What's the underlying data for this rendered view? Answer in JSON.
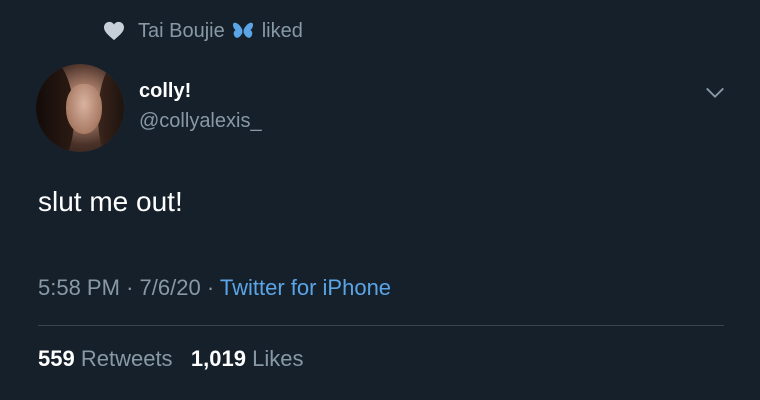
{
  "liked_by": {
    "name": "Tai Boujie",
    "action": "liked",
    "heart_icon": "heart-icon",
    "badge_icon": "butterfly-icon"
  },
  "author": {
    "display_name": "colly!",
    "handle": "@collyalexis_"
  },
  "tweet": {
    "text": "slut me out!",
    "time": "5:58 PM",
    "separator": "·",
    "date": "7/6/20",
    "source": "Twitter for iPhone"
  },
  "stats": {
    "retweets_count": "559",
    "retweets_label": "Retweets",
    "likes_count": "1,019",
    "likes_label": "Likes"
  },
  "colors": {
    "background": "#15202b",
    "secondary_text": "#8899a6",
    "link": "#5ba4e6",
    "divider": "#38444d"
  }
}
